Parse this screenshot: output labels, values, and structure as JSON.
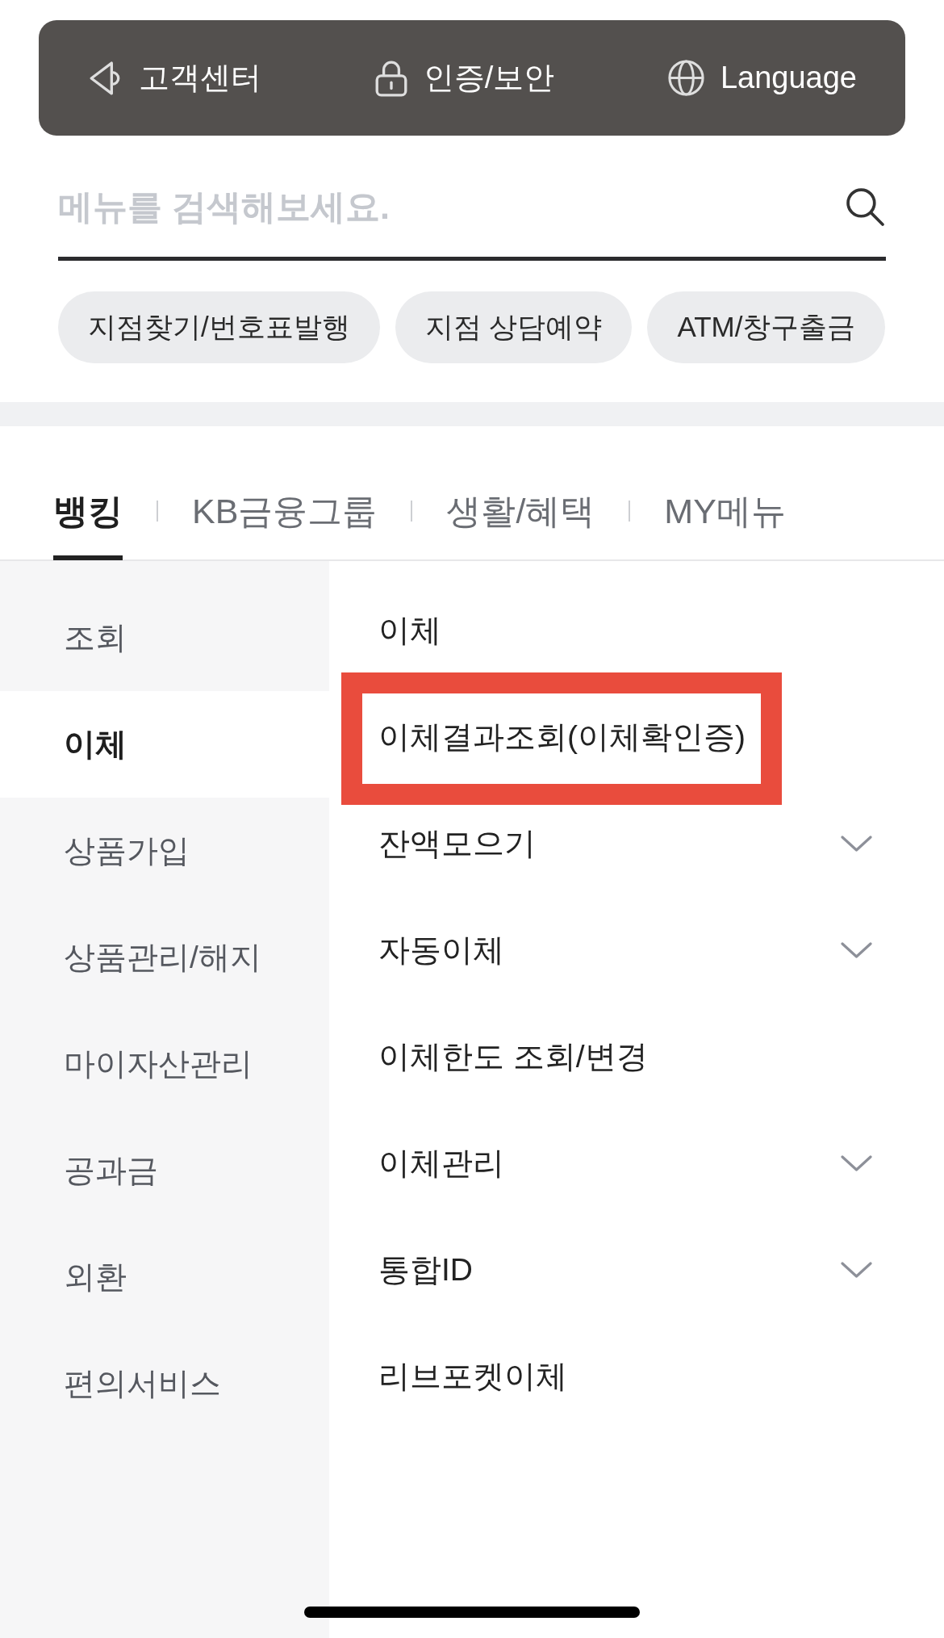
{
  "top_bar": {
    "items": [
      {
        "kind": "customer_center",
        "label": "고객센터"
      },
      {
        "kind": "security",
        "label": "인증/보안"
      },
      {
        "kind": "language",
        "label": "Language"
      }
    ]
  },
  "search": {
    "placeholder": "메뉴를 검색해보세요."
  },
  "quick_links": [
    {
      "label": "지점찾기/번호표발행"
    },
    {
      "label": "지점 상담예약"
    },
    {
      "label": "ATM/창구출금"
    }
  ],
  "tabs": [
    {
      "label": "뱅킹",
      "selected": true
    },
    {
      "label": "KB금융그룹",
      "selected": false
    },
    {
      "label": "생활/혜택",
      "selected": false
    },
    {
      "label": "MY메뉴",
      "selected": false
    }
  ],
  "sidebar": {
    "items": [
      {
        "label": "조회",
        "selected": false
      },
      {
        "label": "이체",
        "selected": true
      },
      {
        "label": "상품가입",
        "selected": false
      },
      {
        "label": "상품관리/해지",
        "selected": false
      },
      {
        "label": "마이자산관리",
        "selected": false
      },
      {
        "label": "공과금",
        "selected": false
      },
      {
        "label": "외환",
        "selected": false
      },
      {
        "label": "편의서비스",
        "selected": false
      }
    ]
  },
  "submenu": {
    "items": [
      {
        "label": "이체",
        "expandable": false,
        "highlighted": false
      },
      {
        "label": "이체결과조회(이체확인증)",
        "expandable": false,
        "highlighted": true
      },
      {
        "label": "잔액모으기",
        "expandable": true,
        "highlighted": false
      },
      {
        "label": "자동이체",
        "expandable": true,
        "highlighted": false
      },
      {
        "label": "이체한도 조회/변경",
        "expandable": false,
        "highlighted": false
      },
      {
        "label": "이체관리",
        "expandable": true,
        "highlighted": false
      },
      {
        "label": "통합ID",
        "expandable": true,
        "highlighted": false
      },
      {
        "label": "리브포켓이체",
        "expandable": false,
        "highlighted": false
      }
    ]
  }
}
